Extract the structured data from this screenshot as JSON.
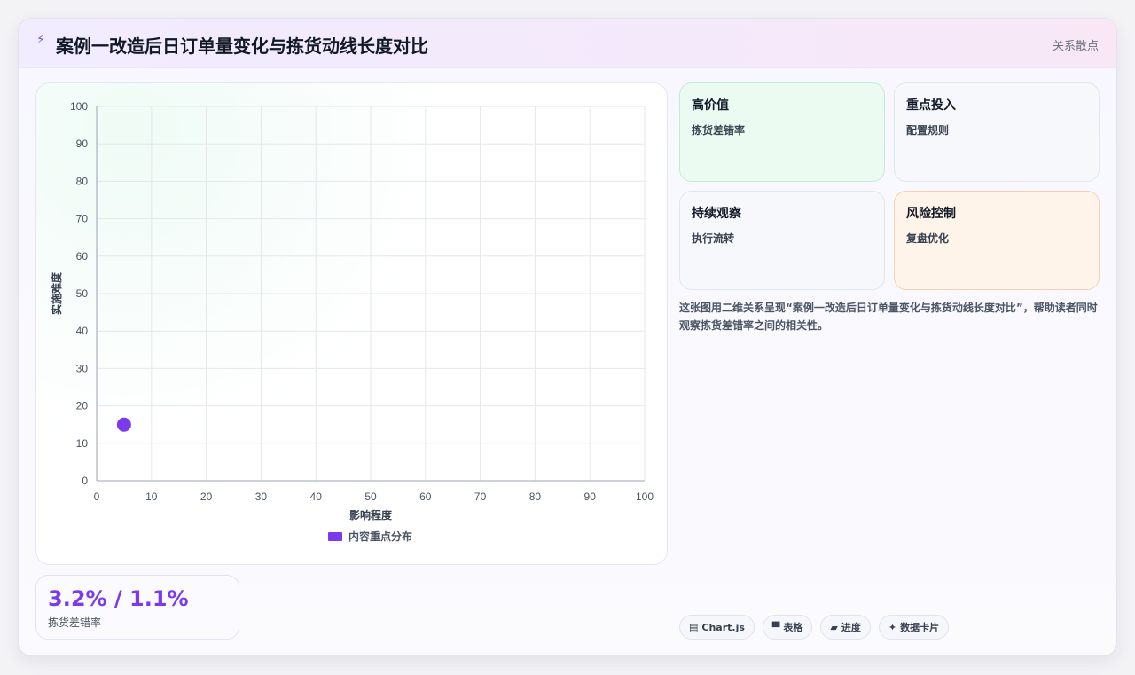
{
  "header": {
    "icon": "bolt-icon",
    "title": "案例一改造后日订单量变化与拣货动线长度对比",
    "tag": "关系散点"
  },
  "chart_data": {
    "type": "scatter",
    "xlabel": "影响程度",
    "ylabel": "实施难度",
    "xlim": [
      0,
      100
    ],
    "ylim": [
      0,
      100
    ],
    "xticks": [
      "0",
      "10",
      "20",
      "30",
      "40",
      "50",
      "60",
      "70",
      "80",
      "90",
      "100"
    ],
    "yticks": [
      "0",
      "10",
      "20",
      "30",
      "40",
      "50",
      "60",
      "70",
      "80",
      "90",
      "100"
    ],
    "grid": true,
    "legend_position": "bottom",
    "series": [
      {
        "name": "内容重点分布",
        "color": "#7c3aed",
        "points": [
          {
            "x": 5,
            "y": 15
          }
        ]
      }
    ]
  },
  "quadrants": [
    {
      "title": "高价值",
      "sub": "拣货差错率"
    },
    {
      "title": "重点投入",
      "sub": "配置规则"
    },
    {
      "title": "持续观察",
      "sub": "执行流转"
    },
    {
      "title": "风险控制",
      "sub": "复盘优化"
    }
  ],
  "description": "这张图用二维关系呈现“案例一改造后日订单量变化与拣货动线长度对比”，帮助读者同时观察拣货差错率之间的相关性。",
  "stat": {
    "value": "3.2% / 1.1%",
    "label": "拣货差错率"
  },
  "chips": [
    {
      "icon": "▤",
      "label": "Chart.js"
    },
    {
      "icon": "▀",
      "label": "表格"
    },
    {
      "icon": "▰",
      "label": "进度"
    },
    {
      "icon": "✦",
      "label": "数据卡片"
    }
  ],
  "colors": {
    "accent": "#7c3aed",
    "grid": "#e5e7eb",
    "axis": "#9ca3af"
  }
}
